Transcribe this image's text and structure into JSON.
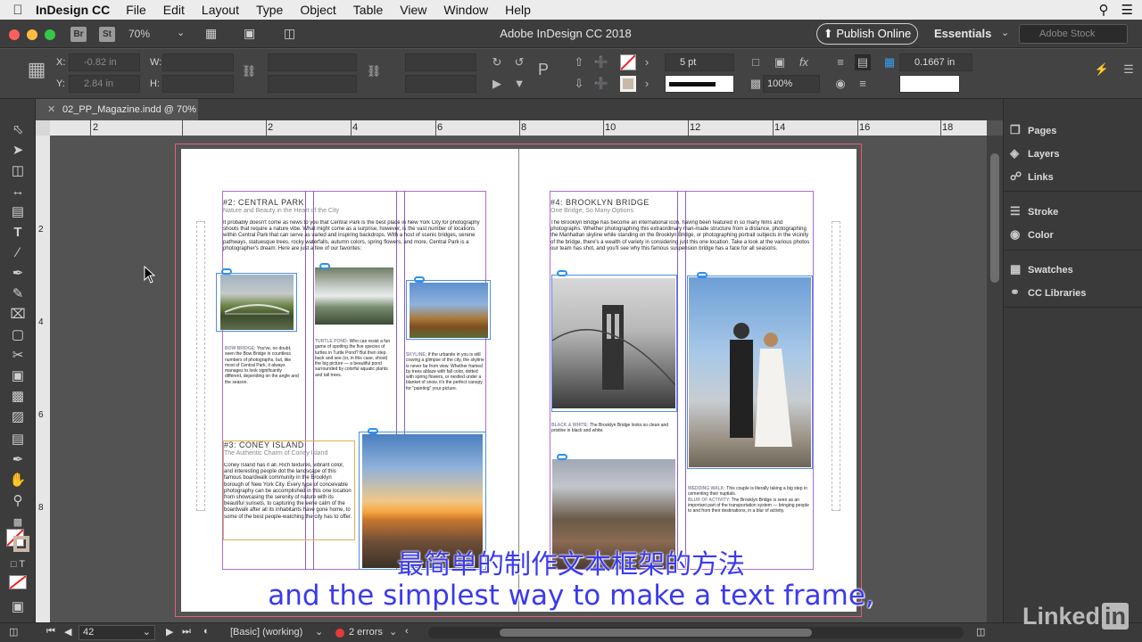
{
  "menubar": {
    "app": "InDesign CC",
    "items": [
      "File",
      "Edit",
      "Layout",
      "Type",
      "Object",
      "Table",
      "View",
      "Window",
      "Help"
    ]
  },
  "titlebar": {
    "zoom": "70%",
    "br": "Br",
    "st": "St",
    "title": "Adobe InDesign CC 2018",
    "publish": "Publish Online",
    "workspace": "Essentials",
    "stock_placeholder": "Adobe Stock"
  },
  "control": {
    "x_label": "X:",
    "x_value": "-0.82 in",
    "y_label": "Y:",
    "y_value": "2.84 in",
    "w_label": "W:",
    "h_label": "H:",
    "stroke_weight": "5 pt",
    "scale": "100%",
    "offset": "0.1667 in"
  },
  "document_tab": {
    "label": "02_PP_Magazine.indd @ 70%"
  },
  "ruler": {
    "h_labels": [
      "2",
      "2",
      "4",
      "6",
      "8",
      "10",
      "12",
      "14",
      "16",
      "18"
    ],
    "v_labels": [
      "2",
      "4",
      "6",
      "8"
    ]
  },
  "spread": {
    "left": {
      "central_park": {
        "heading": "#2: CENTRAL PARK",
        "sub": "Nature and Beauty in the Heart of the City",
        "body": "It probably doesn't come as news to you that Central Park is the best place in New York City for photography shoots that require a nature vibe. What might come as a surprise, however, is the vast number of locations within Central Park that can serve as varied and inspiring backdrops. With a host of scenic bridges, serene pathways, statuesque trees, rocky waterfalls, autumn colors, spring flowers, and more, Central Park is a photographer's dream. Here are just a few of our favorites:",
        "captions": [
          {
            "title": "BOW BRIDGE:",
            "text": "You've, no doubt, seen the Bow Bridge in countless numbers of photographs, but, like most of Central Park, it always manages to look significantly different, depending on the angle and the season."
          },
          {
            "title": "TURTLE POND:",
            "text": "Who can resist a fun game of spotting the five species of turtles in Turtle Pond? But then step back and see (or, in this case, shoot) the big picture — a beautiful pond surrounded by colorful aquatic plants and tall trees."
          },
          {
            "title": "SKYLINE:",
            "text": "If the urbanite in you is still craving a glimpse of the city, the skyline is never far from view. Whether framed by trees ablaze with fall color, dotted with spring flowers, or nestled under a blanket of snow, it's the perfect canopy for \"painting\" your picture."
          }
        ]
      },
      "coney_island": {
        "heading": "#3: CONEY ISLAND",
        "sub": "The Authentic Charm of Coney Island",
        "body": "Coney Island has it all. Rich textures, vibrant color, and interesting people dot the landscape of this famous boardwalk community in the Brooklyn borough of New York City. Every type of conceivable photography can be accomplished in this one location from showcasing the serenity of nature with its beautiful sunsets, to capturing the eerie calm of the boardwalk after all its inhabitants have gone home, to some of the best people-watching the city has to offer."
      }
    },
    "right": {
      "heading": "#4: BROOKLYN BRIDGE",
      "sub": "One Bridge, So Many Options",
      "body": "The Brooklyn Bridge has become an international icon, having been featured in so many films and photographs. Whether photographing this extraordinary man-made structure from a distance, photographing the Manhattan skyline while standing on the Brooklyn Bridge, or photographing portrait subjects in the vicinity of the bridge, there's a wealth of variety in considering just this one location. Take a look at the various photos our team has shot, and you'll see why this famous suspension bridge has a face for all seasons.",
      "captions": [
        {
          "title": "BLACK & WHITE:",
          "text": "The Brooklyn Bridge looks so clean and pristine in black and white."
        },
        {
          "title": "WEDDING WALK:",
          "text": "This couple is literally taking a big step in cementing their nuptials."
        },
        {
          "title": "BLUR OF ACTIVITY:",
          "text": "The Brooklyn Bridge is seen as an important part of the transportation system — bringing people to and from their destinations, in a blur of activity."
        }
      ]
    }
  },
  "panels": [
    "Pages",
    "Layers",
    "Links",
    "Stroke",
    "Color",
    "Swatches",
    "CC Libraries"
  ],
  "status": {
    "page": "42",
    "preflight_profile": "[Basic] (working)",
    "errors": "2 errors"
  },
  "subtitles": {
    "cn": "最简单的制作文本框架的方法",
    "en": "and the simplest way to make a text frame,"
  },
  "watermark": {
    "text": "Linked",
    "in": "in"
  }
}
